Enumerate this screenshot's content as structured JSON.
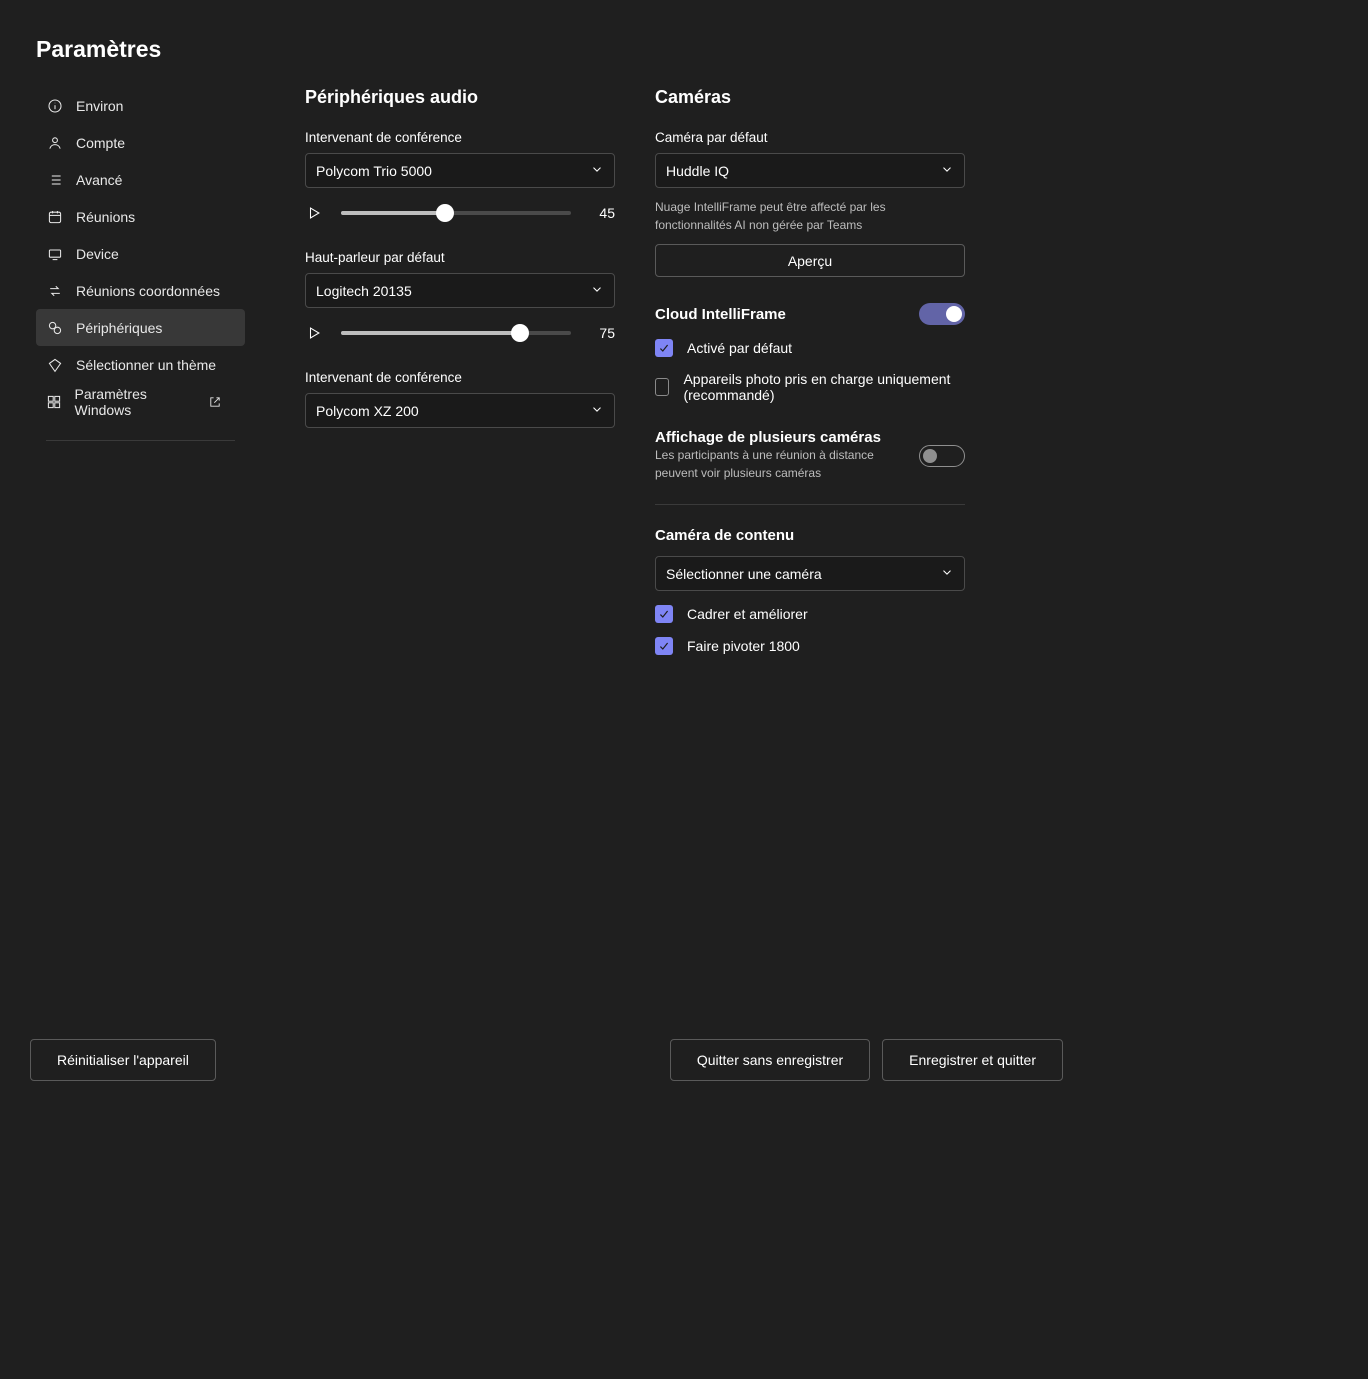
{
  "page": {
    "title": "Paramètres"
  },
  "sidebar": {
    "items": [
      {
        "label": "Environ"
      },
      {
        "label": "Compte"
      },
      {
        "label": "Avancé"
      },
      {
        "label": "Réunions"
      },
      {
        "label": "Device"
      },
      {
        "label": "Réunions coordonnées"
      },
      {
        "label": "Périphériques"
      },
      {
        "label": "Sélectionner un thème"
      },
      {
        "label": "Paramètres Windows"
      }
    ]
  },
  "audio": {
    "heading": "Périphériques audio",
    "conf_speaker1_label": "Intervenant de conférence",
    "conf_speaker1_value": "Polycom Trio 5000",
    "conf_speaker1_vol": "45",
    "default_speaker_label": "Haut-parleur par défaut",
    "default_speaker_value": "Logitech 20135",
    "default_speaker_vol": "75",
    "conf_speaker2_label": "Intervenant de conférence",
    "conf_speaker2_value": "Polycom XZ 200"
  },
  "camera": {
    "heading": "Caméras",
    "default_label": "Caméra par défaut",
    "default_value": "Huddle IQ",
    "hint_tag": "Nuage",
    "hint_text": "IntelliFrame peut être affecté par les fonctionnalités AI non gérée par Teams",
    "preview_btn": "Aperçu",
    "intelliframe_label": "Cloud IntelliFrame",
    "intelliframe_enabled_label": "Activé par défaut",
    "intelliframe_supported_label": "Appareils photo pris en charge uniquement (recommandé)",
    "multi_label": "Affichage de plusieurs caméras",
    "multi_desc": "Les participants à une réunion à distance peuvent voir plusieurs caméras",
    "content_label": "Caméra de contenu",
    "content_value": "Sélectionner une caméra",
    "crop_label": "Cadrer et améliorer",
    "rotate_label": "Faire pivoter 1800"
  },
  "footer": {
    "reset": "Réinitialiser l'appareil",
    "exit": "Quitter sans enregistrer",
    "save": "Enregistrer et quitter"
  }
}
